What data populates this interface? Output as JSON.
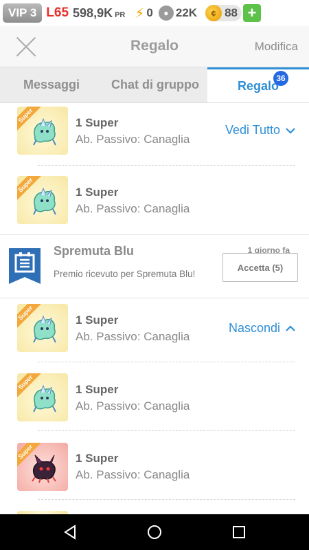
{
  "status": {
    "vip": "VIP 3",
    "level": "L65",
    "power": "598,9K",
    "power_unit": "PR",
    "energy": "0",
    "paw": "22K",
    "coins": "88",
    "add_label": "+"
  },
  "header": {
    "title": "Regalo",
    "edit_label": "Modifica"
  },
  "tabs": [
    {
      "label": "Messaggi",
      "active": false
    },
    {
      "label": "Chat di gruppo",
      "active": false
    },
    {
      "label": "Regalo",
      "active": true,
      "badge": "36"
    }
  ],
  "gift_groups": [
    {
      "toggle_label": "Vedi Tutto",
      "items": [
        {
          "name": "1 Super",
          "ability": "Ab. Passivo: Canaglia",
          "ribbon": "Super",
          "variant": "green"
        },
        {
          "name": "1 Super",
          "ability": "Ab. Passivo: Canaglia",
          "ribbon": "Super",
          "variant": "green"
        }
      ]
    },
    {
      "toggle_label": "Nascondi",
      "items": [
        {
          "name": "1 Super",
          "ability": "Ab. Passivo: Canaglia",
          "ribbon": "Super",
          "variant": "green"
        },
        {
          "name": "1 Super",
          "ability": "Ab. Passivo: Canaglia",
          "ribbon": "Super",
          "variant": "green"
        },
        {
          "name": "1 Super",
          "ability": "Ab. Passivo: Canaglia",
          "ribbon": "Super",
          "variant": "red"
        }
      ]
    }
  ],
  "mail": {
    "title": "Spremuta Blu",
    "text": "Premio ricevuto per Spremuta Blu!",
    "time": "1 giorno fa",
    "accept_label": "Accetta (5)"
  },
  "colors": {
    "accent": "#2f8fd6",
    "badge": "#2468e2",
    "level": "#e8302a",
    "add": "#5cc24a",
    "ribbon": "#f3a83b"
  }
}
